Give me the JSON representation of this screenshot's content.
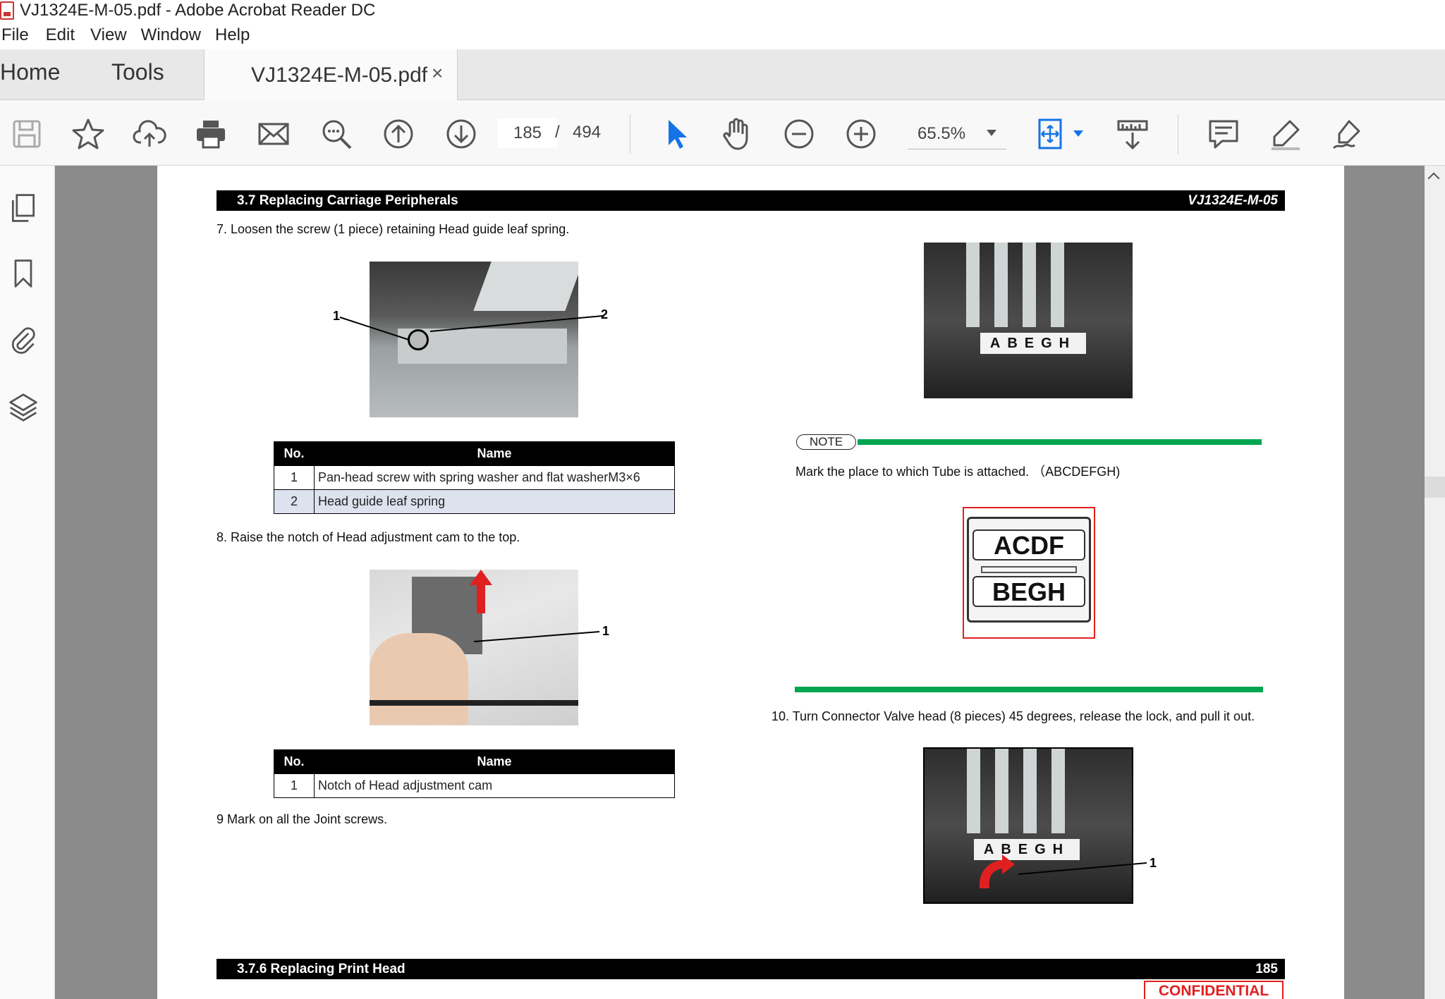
{
  "window": {
    "title": "VJ1324E-M-05.pdf - Adobe Acrobat Reader DC"
  },
  "menu": [
    "File",
    "Edit",
    "View",
    "Window",
    "Help"
  ],
  "tabs": {
    "home": "Home",
    "tools": "Tools",
    "document": "VJ1324E-M-05.pdf",
    "close": "×"
  },
  "toolbar": {
    "page_current": "185",
    "page_separator": "/",
    "page_total": "494",
    "zoom": "65.5%"
  },
  "icons": {
    "save": "save-icon",
    "bookmark_star": "star-icon",
    "upload": "cloud-upload-icon",
    "print": "printer-icon",
    "email": "mail-icon",
    "find": "search-icon",
    "prev_page": "arrow-up-circle-icon",
    "next_page": "arrow-down-circle-icon",
    "select": "cursor-arrow-icon",
    "hand": "hand-icon",
    "zoom_out": "minus-circle-icon",
    "zoom_in": "plus-circle-icon",
    "fit": "fit-page-icon",
    "scroll_mode": "scroll-mode-icon",
    "comment": "comment-icon",
    "highlight": "pen-icon",
    "sign": "sign-icon"
  },
  "colors": {
    "accent_blue": "#1473e6",
    "green_rule": "#00a550",
    "red_highlight": "#e02020"
  },
  "page": {
    "header_left": "3.7 Replacing Carriage Peripherals",
    "header_right": "VJ1324E-M-05",
    "step7": "7.    Loosen the screw (1 piece) retaining Head guide leaf spring.",
    "table1": {
      "headers": [
        "No.",
        "Name"
      ],
      "rows": [
        [
          "1",
          "Pan-head screw with spring washer and flat washerM3×6"
        ],
        [
          "2",
          "Head guide leaf spring"
        ]
      ]
    },
    "step8": "8.    Raise the notch of Head adjustment cam to the top.",
    "table2": {
      "headers": [
        "No.",
        "Name"
      ],
      "rows": [
        [
          "1",
          "Notch of Head adjustment cam"
        ]
      ]
    },
    "step9": "9     Mark on all the Joint screws.",
    "note_label": "NOTE",
    "note_text": "Mark the place to which Tube is attached.  （ABCDEFGH)",
    "diagram_top": "ACDF",
    "diagram_bottom": "BEGH",
    "step10": "10.  Turn Connector Valve head (8 pieces) 45 degrees, release the lock, and pull it out.",
    "photo_labels": "ABEGH",
    "callouts": {
      "one": "1",
      "two": "2"
    },
    "footer_left": "3.7.6 Replacing Print Head",
    "footer_right": "185",
    "stamp": "CONFIDENTIAL"
  }
}
